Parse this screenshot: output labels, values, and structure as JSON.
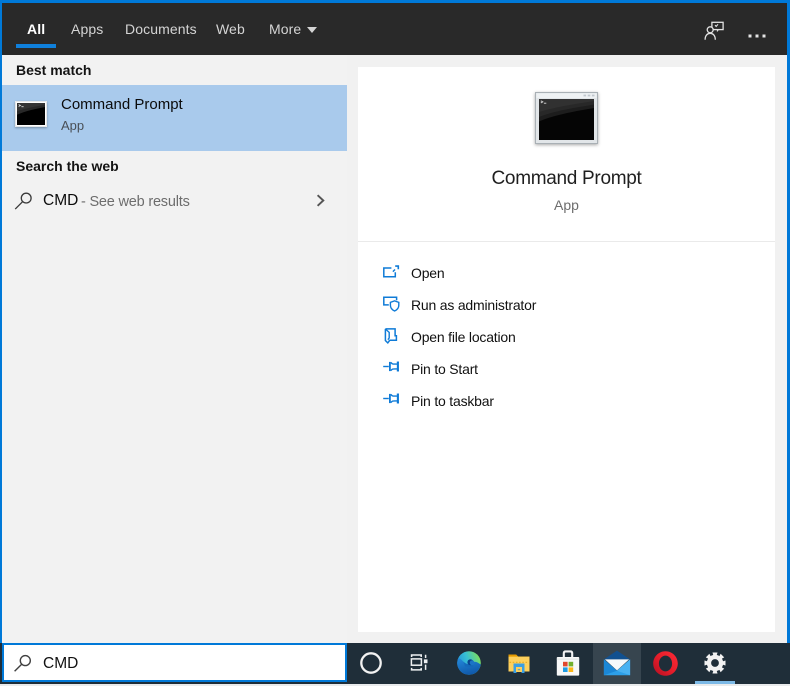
{
  "tabs": {
    "items": [
      {
        "label": "All",
        "active": true
      },
      {
        "label": "Apps",
        "active": false
      },
      {
        "label": "Documents",
        "active": false
      },
      {
        "label": "Web",
        "active": false
      },
      {
        "label": "More",
        "active": false,
        "dropdown": true
      }
    ]
  },
  "left_panel": {
    "best_match_header": "Best match",
    "best_match": {
      "title": "Command Prompt",
      "subtitle": "App"
    },
    "search_web_header": "Search the web",
    "web_item": {
      "query": "CMD",
      "suffix": "- See web results"
    }
  },
  "preview": {
    "title": "Command Prompt",
    "subtitle": "App",
    "actions": [
      {
        "label": "Open"
      },
      {
        "label": "Run as administrator"
      },
      {
        "label": "Open file location"
      },
      {
        "label": "Pin to Start"
      },
      {
        "label": "Pin to taskbar"
      }
    ]
  },
  "header_icons": [
    {
      "name": "feedback-user"
    },
    {
      "name": "see-more-ellipsis"
    }
  ],
  "taskbar": {
    "search_value": "CMD",
    "icons": [
      {
        "name": "cortana"
      },
      {
        "name": "task-view"
      },
      {
        "name": "edge"
      },
      {
        "name": "file-explorer"
      },
      {
        "name": "store"
      },
      {
        "name": "mail",
        "highlighted": true
      },
      {
        "name": "opera"
      },
      {
        "name": "settings",
        "running": true
      }
    ]
  },
  "colors": {
    "accent": "#0079d8",
    "topbar_bg": "#292929",
    "panel_bg": "#f2f2f2",
    "highlight_bg": "#a9caec",
    "taskbar_bg": "#1f2e39",
    "action_icon_blue": "#0f7bd7"
  }
}
